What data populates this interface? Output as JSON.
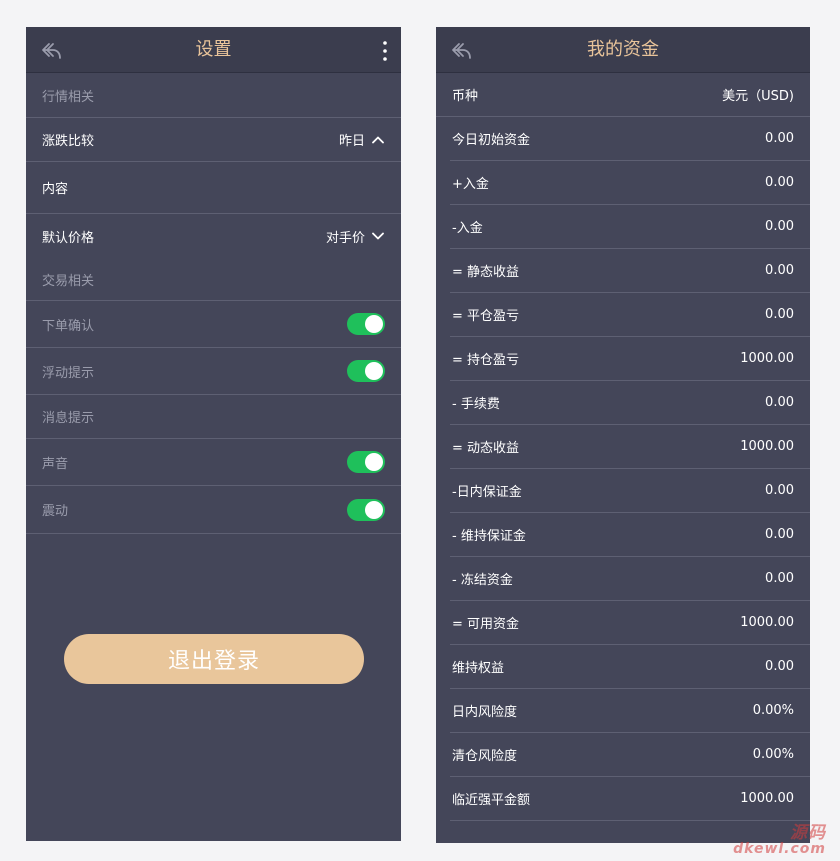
{
  "settings": {
    "title": "设置",
    "rows": [
      {
        "label": "行情相关",
        "kind": "section"
      },
      {
        "label": "涨跌比较",
        "value": "昨日",
        "kind": "select-up"
      },
      {
        "label": "内容",
        "kind": "item"
      },
      {
        "label": "默认价格",
        "value": "对手价",
        "kind": "select-down"
      },
      {
        "label": "交易相关",
        "kind": "section"
      },
      {
        "label": "下单确认",
        "kind": "toggle",
        "on": true
      },
      {
        "label": "浮动提示",
        "kind": "toggle",
        "on": true
      },
      {
        "label": "消息提示",
        "kind": "section"
      },
      {
        "label": "声音",
        "kind": "toggle",
        "on": true
      },
      {
        "label": "震动",
        "kind": "toggle",
        "on": true
      }
    ],
    "logout_label": "退出登录"
  },
  "funds": {
    "title": "我的资金",
    "rows": [
      {
        "label": "币种",
        "value": "美元（USD)"
      },
      {
        "label": "今日初始资金",
        "value": "0.00"
      },
      {
        "label": "+入金",
        "value": "0.00"
      },
      {
        "label": "-入金",
        "value": "0.00"
      },
      {
        "label": "= 静态收益",
        "value": "0.00"
      },
      {
        "label": "= 平仓盈亏",
        "value": "0.00"
      },
      {
        "label": "= 持仓盈亏",
        "value": "1000.00"
      },
      {
        "label": "- 手续费",
        "value": "0.00"
      },
      {
        "label": "= 动态收益",
        "value": "1000.00"
      },
      {
        "label": "-日内保证金",
        "value": "0.00"
      },
      {
        "label": "- 维持保证金",
        "value": "0.00"
      },
      {
        "label": "- 冻结资金",
        "value": "0.00"
      },
      {
        "label": "= 可用资金",
        "value": "1000.00"
      },
      {
        "label": "维持权益",
        "value": "0.00"
      },
      {
        "label": "日内风险度",
        "value": "0.00%"
      },
      {
        "label": "清仓风险度",
        "value": "0.00%"
      },
      {
        "label": "临近强平金额",
        "value": "1000.00"
      }
    ]
  },
  "watermark": {
    "line1": "源码",
    "line2": "dkewl.com"
  },
  "colors": {
    "accent": "#e9c49a",
    "toggle_on": "#1fc05b",
    "panel_bg": "#444659"
  }
}
